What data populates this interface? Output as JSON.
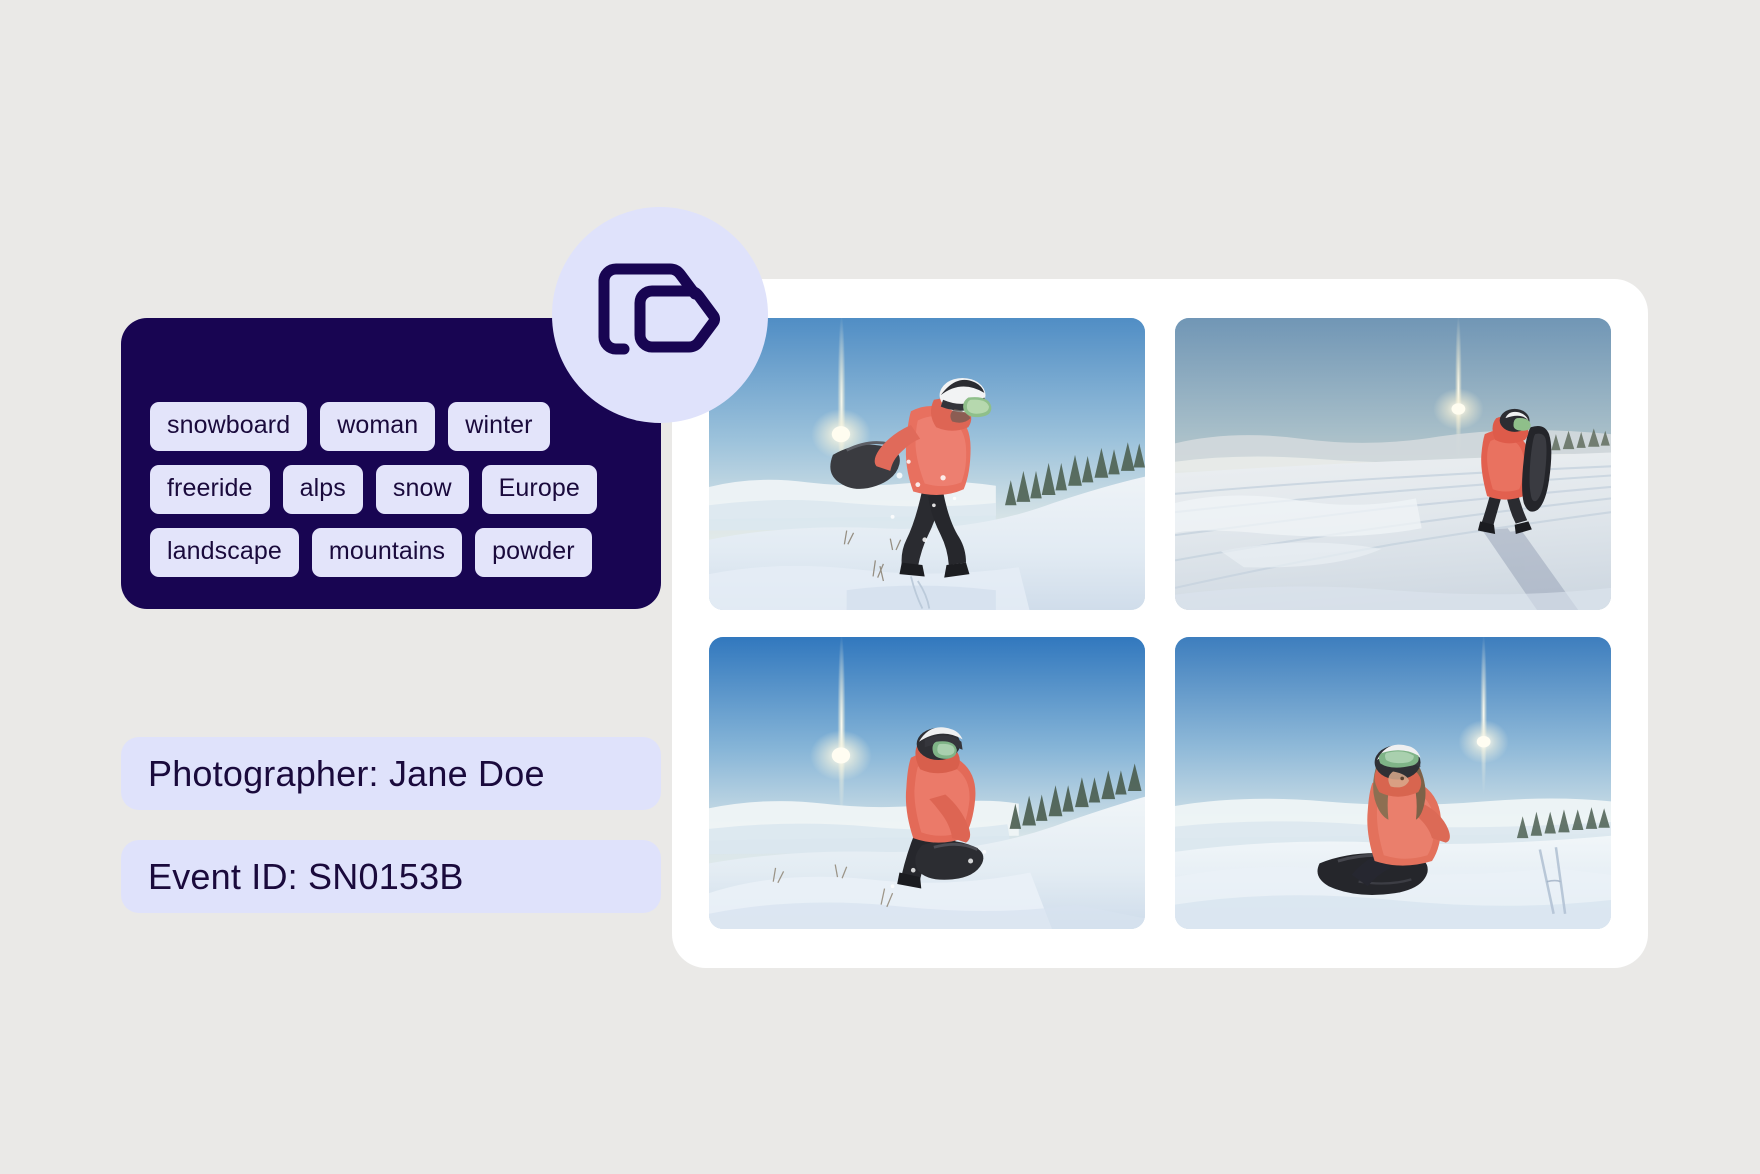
{
  "theme": {
    "page_background": "#eae9e7",
    "panel_navy": "#180552",
    "chip_lavender": "#e3e4fa",
    "pill_lavender": "#dfe2fb",
    "card_white": "#ffffff",
    "text_dark": "#1a0a3c"
  },
  "badge": {
    "icon": "tags-icon",
    "icon_color": "#180552",
    "background": "#dfe2fb"
  },
  "tag_panel": {
    "rows": [
      [
        {
          "label": "snowboard"
        },
        {
          "label": "woman"
        },
        {
          "label": "winter"
        }
      ],
      [
        {
          "label": "freeride"
        },
        {
          "label": "alps"
        },
        {
          "label": "snow"
        },
        {
          "label": "Europe"
        }
      ],
      [
        {
          "label": "landscape"
        },
        {
          "label": "mountains"
        },
        {
          "label": "powder"
        }
      ]
    ]
  },
  "metadata": {
    "photographer": "Photographer: Jane Doe",
    "event_id": "Event ID: SN0153B"
  },
  "gallery": {
    "photos": [
      {
        "name": "photo-snowboarder-jumping",
        "alt": "Snowboarder in red jacket leaping on a snowy ridge with sun flare",
        "sky_top": "#5d93c4",
        "sky_bottom": "#dfe6e8",
        "jacket": "#e8705f",
        "variant": "jump"
      },
      {
        "name": "photo-snowboarder-walking",
        "alt": "Snowboarder carrying board walking across a groomed snow field, long shadow",
        "sky_top": "#7d9fba",
        "sky_bottom": "#e8dfd2",
        "jacket": "#e2604f",
        "variant": "walk"
      },
      {
        "name": "photo-snowboarder-crouching",
        "alt": "Snowboarder crouching and strapping in on a snowy slope above clouds",
        "sky_top": "#3f7fbe",
        "sky_bottom": "#dde8ea",
        "jacket": "#e36a58",
        "variant": "crouch"
      },
      {
        "name": "photo-snowboarder-sitting",
        "alt": "Snowboarder sitting in snow with board, smiling toward the camera",
        "sky_top": "#4a86c4",
        "sky_bottom": "#e2ebec",
        "jacket": "#e3715c",
        "variant": "sit"
      }
    ]
  }
}
